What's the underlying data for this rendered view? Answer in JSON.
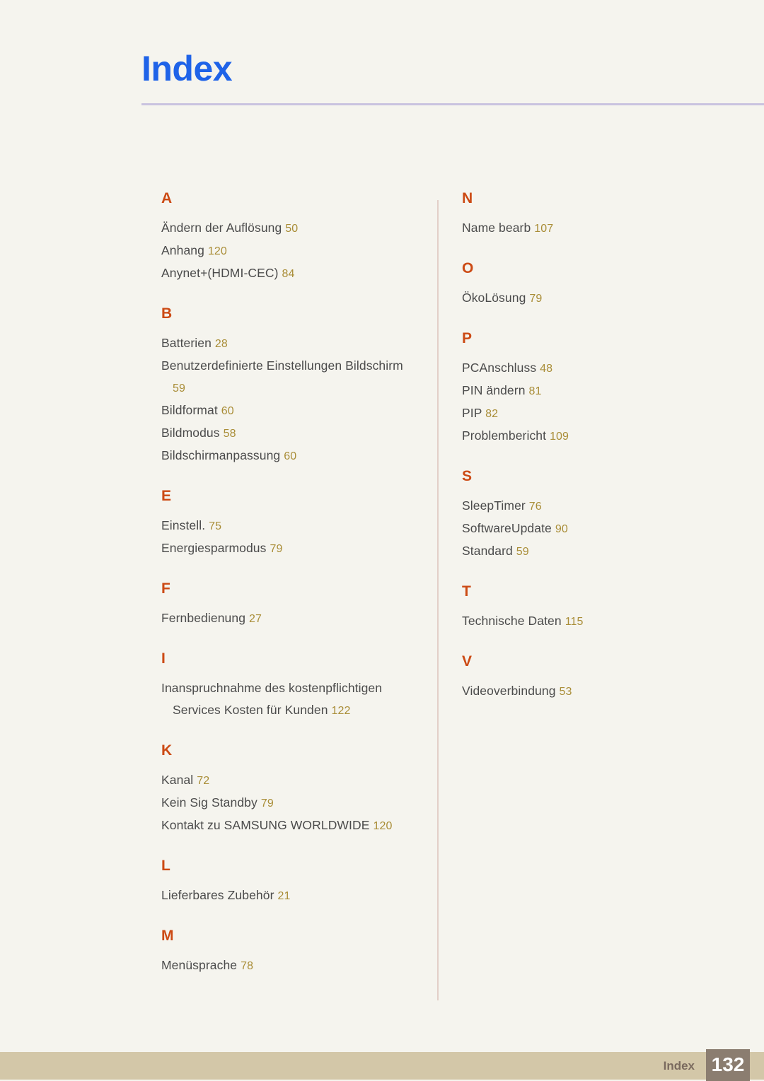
{
  "header": {
    "title": "Index"
  },
  "colors": {
    "background": "#f5f4ee",
    "title": "#1f63e8",
    "rule": "#c9c3df",
    "section_letter": "#cc4a14",
    "entry_text": "#4b4b4b",
    "page_number": "#a98d37",
    "divider": "#e3cfc8",
    "footer_bar": "#d3c7a8",
    "footer_label": "#7a6a5e",
    "footer_pagebox": "#8b7d70",
    "footer_pagenum": "#ffffff"
  },
  "columns": [
    {
      "sections": [
        {
          "letter": "A",
          "entries": [
            {
              "title": "Ändern der Auflösung",
              "page": "50"
            },
            {
              "title": "Anhang",
              "page": "120"
            },
            {
              "title": "Anynet+(HDMI-CEC)",
              "page": "84"
            }
          ]
        },
        {
          "letter": "B",
          "entries": [
            {
              "title": "Batterien",
              "page": "28"
            },
            {
              "title": "Benutzerdefinierte Einstellungen Bildschirm",
              "page": "59"
            },
            {
              "title": "Bildformat",
              "page": "60"
            },
            {
              "title": "Bildmodus",
              "page": "58"
            },
            {
              "title": "Bildschirmanpassung",
              "page": "60"
            }
          ]
        },
        {
          "letter": "E",
          "entries": [
            {
              "title": "Einstell.",
              "page": "75"
            },
            {
              "title": "Energiesparmodus",
              "page": "79"
            }
          ]
        },
        {
          "letter": "F",
          "entries": [
            {
              "title": "Fernbedienung",
              "page": "27"
            }
          ]
        },
        {
          "letter": "I",
          "entries": [
            {
              "title": "Inanspruchnahme des kostenpflichtigen Services Kosten für Kunden",
              "page": "122"
            }
          ]
        },
        {
          "letter": "K",
          "entries": [
            {
              "title": "Kanal",
              "page": "72"
            },
            {
              "title": "Kein Sig Standby",
              "page": "79"
            },
            {
              "title": "Kontakt zu SAMSUNG WORLDWIDE",
              "page": "120"
            }
          ]
        },
        {
          "letter": "L",
          "entries": [
            {
              "title": "Lieferbares Zubehör",
              "page": "21"
            }
          ]
        },
        {
          "letter": "M",
          "entries": [
            {
              "title": "Menüsprache",
              "page": "78"
            }
          ]
        }
      ]
    },
    {
      "sections": [
        {
          "letter": "N",
          "entries": [
            {
              "title": "Name bearb",
              "page": "107"
            }
          ]
        },
        {
          "letter": "O",
          "entries": [
            {
              "title": "ÖkoLösung",
              "page": "79"
            }
          ]
        },
        {
          "letter": "P",
          "entries": [
            {
              "title": "PCAnschluss",
              "page": "48"
            },
            {
              "title": "PIN ändern",
              "page": "81"
            },
            {
              "title": "PIP",
              "page": "82"
            },
            {
              "title": "Problembericht",
              "page": "109"
            }
          ]
        },
        {
          "letter": "S",
          "entries": [
            {
              "title": "SleepTimer",
              "page": "76"
            },
            {
              "title": "SoftwareUpdate",
              "page": "90"
            },
            {
              "title": "Standard",
              "page": "59"
            }
          ]
        },
        {
          "letter": "T",
          "entries": [
            {
              "title": "Technische Daten",
              "page": "115"
            }
          ]
        },
        {
          "letter": "V",
          "entries": [
            {
              "title": "Videoverbindung",
              "page": "53"
            }
          ]
        }
      ]
    }
  ],
  "footer": {
    "label": "Index",
    "page_number": "132"
  }
}
